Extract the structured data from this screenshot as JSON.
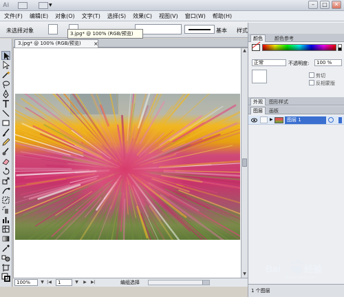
{
  "title_bar": {
    "app_logo_text": "Ai",
    "controls": {
      "minimize": "–",
      "maximize": "□",
      "close": "✕"
    }
  },
  "menu": [
    "文件(F)",
    "编辑(E)",
    "对象(O)",
    "文字(T)",
    "选择(S)",
    "效果(C)",
    "视图(V)",
    "窗口(W)",
    "帮助(H)"
  ],
  "control_bar": {
    "selection_label": "未选择对象",
    "stroke_style_label": "基本",
    "style_label": "样式:"
  },
  "document": {
    "tab_title": "3.jpg* @ 100% (RGB/预览)",
    "tab_close": "×",
    "tooltip": "3.jpg* @ 100% (RGB/预览)"
  },
  "status_bar": {
    "zoom": "100%",
    "page": "1",
    "status_text": "编组选择"
  },
  "panels": {
    "color_tabs": [
      "颜色",
      "颜色参考"
    ],
    "transparency": {
      "blend_mode": "正常",
      "opacity_label": "不透明度:",
      "opacity_value": "100 %",
      "clip_label": "剪切",
      "invert_mask_label": "反相蒙版"
    },
    "appearance_tabs": [
      "外观",
      "图形样式"
    ],
    "layers_tabs": [
      "图层",
      "画板"
    ],
    "layer": {
      "name": "图层 1"
    },
    "layer_count": "1 个图层"
  },
  "watermark": {
    "text": "Bai经验",
    "sub": "jingyan.baidu.com"
  },
  "colors": {
    "selection_blue": "#3a6fd0",
    "canvas_gray": "#a6a8ab",
    "panel_bg": "#d8dbe0"
  }
}
